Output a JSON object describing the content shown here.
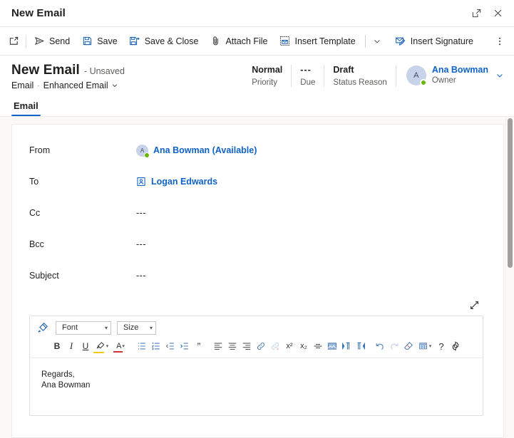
{
  "window": {
    "title": "New Email",
    "popout_label": "Pop out",
    "close_label": "Close"
  },
  "command_bar": {
    "new_label": "New",
    "items": [
      {
        "label": "Send",
        "icon": "send-icon"
      },
      {
        "label": "Save",
        "icon": "save-icon"
      },
      {
        "label": "Save & Close",
        "icon": "save-close-icon"
      },
      {
        "label": "Attach File",
        "icon": "paperclip-icon"
      },
      {
        "label": "Insert Template",
        "icon": "insert-template-icon"
      },
      {
        "label": "Insert Signature",
        "icon": "insert-signature-icon"
      }
    ],
    "template_chevron": "⌄",
    "overflow_label": "⋮"
  },
  "record_header": {
    "title": "New Email",
    "unsaved": "- Unsaved",
    "entity": "Email",
    "separator": "·",
    "form_name": "Enhanced Email",
    "fields": [
      {
        "value": "Normal",
        "label": "Priority"
      },
      {
        "value": "---",
        "label": "Due"
      },
      {
        "value": "Draft",
        "label": "Status Reason"
      }
    ],
    "owner": {
      "initial": "A",
      "name": "Ana Bowman",
      "role": "Owner"
    }
  },
  "tabs": [
    {
      "label": "Email",
      "selected": true
    }
  ],
  "form": {
    "rows": [
      {
        "label": "From",
        "value": "Ana Bowman (Available)",
        "type": "person",
        "initial": "A"
      },
      {
        "label": "To",
        "value": "Logan Edwards",
        "type": "contact"
      },
      {
        "label": "Cc",
        "value": "---",
        "type": "empty"
      },
      {
        "label": "Bcc",
        "value": "---",
        "type": "empty"
      },
      {
        "label": "Subject",
        "value": "---",
        "type": "empty"
      }
    ]
  },
  "editor": {
    "expand_label": "Expand",
    "font_placeholder": "Font",
    "size_placeholder": "Size",
    "caret": "▾",
    "toolbar": {
      "format_painter": "format-painter-icon",
      "bold": "B",
      "italic": "I",
      "underline": "U",
      "highlight": "A",
      "font_color": "A",
      "buttons": [
        "bullet-list-icon",
        "numbered-list-icon",
        "decrease-indent-icon",
        "increase-indent-icon",
        "blockquote-icon",
        "align-left-icon",
        "align-center-icon",
        "align-right-icon",
        "insert-link-icon",
        "remove-link-icon",
        "superscript-icon",
        "subscript-icon",
        "strikethrough-icon",
        "insert-image-icon",
        "ltr-icon",
        "rtl-icon",
        "undo-icon",
        "redo-icon",
        "clear-format-icon",
        "insert-table-icon",
        "help-icon",
        "settings-icon"
      ],
      "superscript": "x²",
      "subscript": "x₂",
      "quote": "”",
      "help": "?"
    },
    "body_lines": [
      "Regards,",
      "Ana Bowman"
    ]
  },
  "colors": {
    "accent": "#0f62c8",
    "presence_available": "#6bb700",
    "page_bg": "#faf9f8",
    "border": "#edebe9"
  }
}
